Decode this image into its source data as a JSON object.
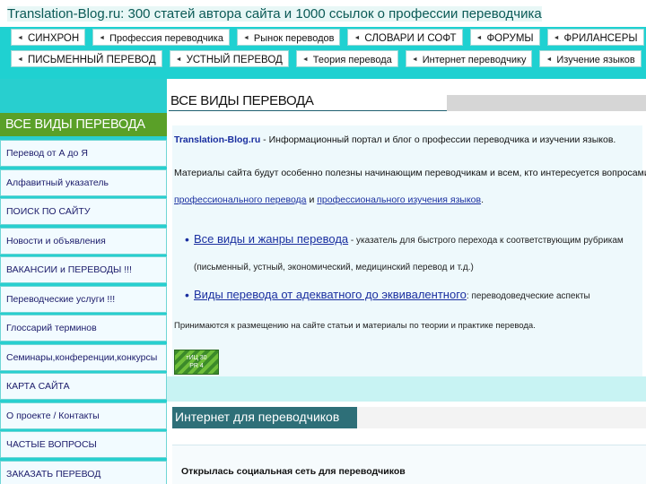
{
  "header": {
    "site_title": "Translation-Blog.ru: 300 статей автора сайта и 1000 ссылок о профессии переводчика"
  },
  "nav": {
    "row1": [
      "СИНХРОН",
      "Профессия переводчика",
      "Рынок переводов",
      "СЛОВАРИ И СОФТ",
      "ФОРУМЫ",
      "ФРИЛАНСЕРЫ"
    ],
    "row2": [
      "ПИСЬМЕННЫЙ ПЕРЕВОД",
      "УСТНЫЙ ПЕРЕВОД",
      "Теория перевода",
      "Интернет переводчику",
      "Изучение языков"
    ]
  },
  "sidebar": {
    "heading": "ВСЕ ВИДЫ ПЕРЕВОДА",
    "items": [
      "Перевод от А до Я",
      "Алфавитный указатель",
      "ПОИСК ПО САЙТУ",
      "Новости и объявления",
      "ВАКАНСИИ и ПЕРЕВОДЫ !!!",
      "Переводческие услуги !!!",
      "Глоссарий терминов",
      "Семинары,конференции,конкурсы",
      "КАРТА САЙТА",
      "О проекте / Контакты",
      "ЧАСТЫЕ ВОПРОСЫ",
      "ЗАКАЗАТЬ ПЕРЕВОД"
    ]
  },
  "main": {
    "heading": "ВСЕ ВИДЫ ПЕРЕВОДА",
    "intro_brand": "Translation-Blog.ru",
    "intro_text": " - Информационный портал и блог о профессии переводчика и изучении языков.",
    "para_text_1": "Материалы сайта будут особенно полезны начинающим переводчикам и всем, кто интересуется вопросами",
    "para_link_1": "профессионального перевода",
    "para_and": " и ",
    "para_link_2": "профессионального изучения языков",
    "para_end": ".",
    "bullets": [
      {
        "link": "Все виды и жанры перевода",
        "text": " - указатель для быстрого перехода к соответствующим рубрикам (письменный, устный, экономический, медицинский перевод и т.д.)"
      },
      {
        "link": "Виды перевода от адекватного до эквивалентного",
        "text": ": переводоведческие аспекты"
      }
    ],
    "note": "Принимаются к размещению на сайте статьи и материалы по теории и практике перевода.",
    "badge": "тИЦ 30\nPR 4",
    "lower_heading": "Интернет для переводчиков",
    "lower_title": "Открылась социальная сеть для переводчиков"
  }
}
